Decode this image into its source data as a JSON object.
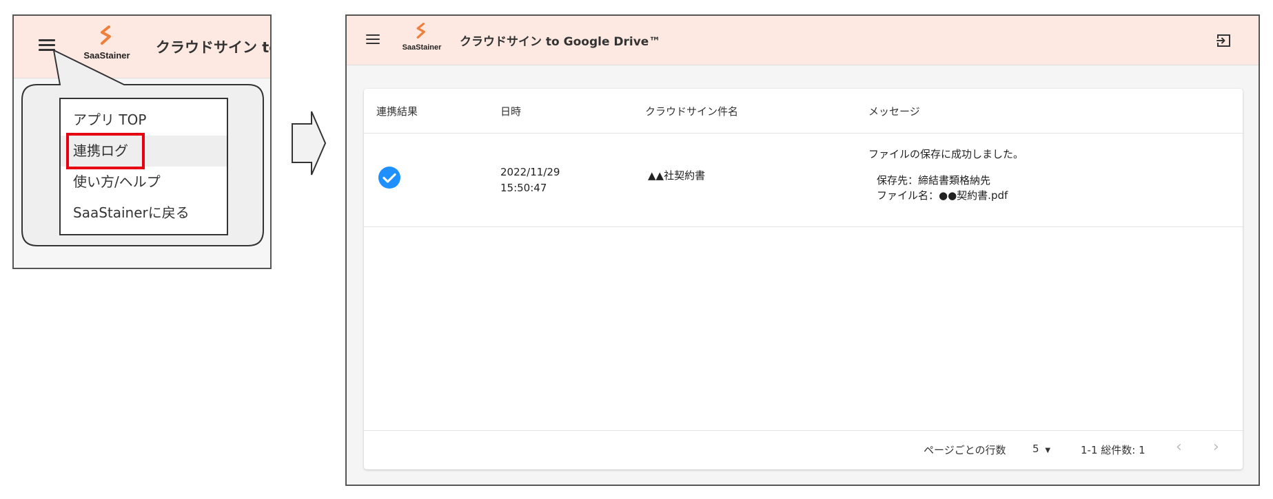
{
  "left": {
    "logo_text": "SaaStainer",
    "app_title": "クラウドサイン to Google Drive™",
    "menu": {
      "items": [
        {
          "label": "アプリ TOP"
        },
        {
          "label": "連携ログ"
        },
        {
          "label": "使い方/ヘルプ"
        },
        {
          "label": "SaaStainerに戻る"
        }
      ],
      "highlight_color": "#e60012"
    }
  },
  "right": {
    "logo_text": "SaaStainer",
    "app_title": "クラウドサイン to Google Drive™",
    "table": {
      "headers": [
        "連携結果",
        "日時",
        "クラウドサイン件名",
        "メッセージ"
      ],
      "rows": [
        {
          "status_icon": "check-circle-icon",
          "date": "2022/11/29",
          "time": "15:50:47",
          "subject": "▲▲社契約書",
          "message": "ファイルの保存に成功しました。",
          "detail_dest": "保存先：締結書類格納先",
          "detail_file": "ファイル名：●●契約書.pdf"
        }
      ]
    },
    "footer": {
      "rows_per_page_label": "ページごとの行数",
      "rows_per_page_value": "5",
      "range_label": "1-1 総件数: 1"
    }
  },
  "colors": {
    "header_bg": "#fde9e1",
    "accent_orange": "#f07f3c",
    "check_blue": "#1e90ff",
    "highlight_red": "#e60012"
  }
}
